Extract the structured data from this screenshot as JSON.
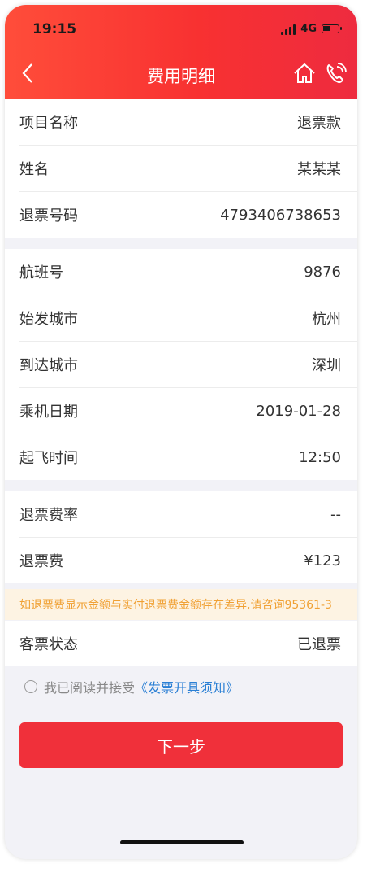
{
  "status_bar": {
    "time": "19:15",
    "network": "4G"
  },
  "nav": {
    "title": "费用明细"
  },
  "section1": [
    {
      "label": "项目名称",
      "value": "退票款"
    },
    {
      "label": "姓名",
      "value": "某某某"
    },
    {
      "label": "退票号码",
      "value": "4793406738653"
    }
  ],
  "section2": [
    {
      "label": "航班号",
      "value": "9876"
    },
    {
      "label": "始发城市",
      "value": "杭州"
    },
    {
      "label": "到达城市",
      "value": "深圳"
    },
    {
      "label": "乘机日期",
      "value": "2019-01-28"
    },
    {
      "label": "起飞时间",
      "value": "12:50"
    }
  ],
  "section3": [
    {
      "label": "退票费率",
      "value": "--"
    },
    {
      "label": "退票费",
      "value": "¥123"
    }
  ],
  "notice": "如退票费显示金额与实付退票费金额存在差异,请咨询95361-3",
  "section4": [
    {
      "label": "客票状态",
      "value": "已退票"
    }
  ],
  "agreement": {
    "prefix": "我已阅读并接受",
    "link": "《发票开具须知》"
  },
  "next_button": "下一步",
  "colors": {
    "header_red": "#f83131",
    "button_red": "#f0303a",
    "notice_text": "#f0a033",
    "link_blue": "#2a7fd4"
  }
}
